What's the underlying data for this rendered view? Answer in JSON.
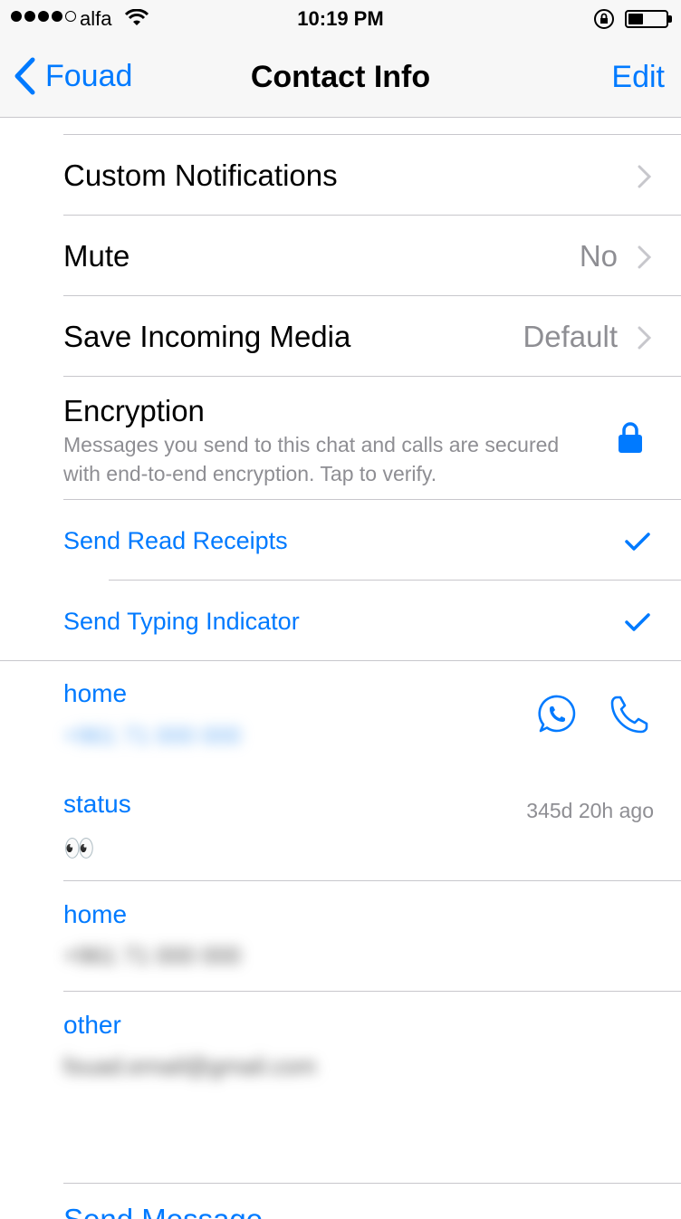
{
  "status_bar": {
    "carrier": "alfa",
    "time": "10:19 PM",
    "signal_bars": 4,
    "signal_total": 5,
    "battery_level": 0.4
  },
  "nav": {
    "back_label": "Fouad",
    "title": "Contact Info",
    "edit_label": "Edit"
  },
  "settings": {
    "custom_notifications": "Custom Notifications",
    "mute_label": "Mute",
    "mute_value": "No",
    "save_media_label": "Save Incoming Media",
    "save_media_value": "Default",
    "encryption_title": "Encryption",
    "encryption_desc": "Messages you send to this chat and calls are secured with end-to-end encryption. Tap to verify.",
    "send_read_receipts": "Send Read Receipts",
    "send_typing_indicator": "Send Typing Indicator"
  },
  "fields": {
    "phone1_label": "home",
    "phone1_value": "+961 71 000 000",
    "status_label": "status",
    "status_time": "345d 20h ago",
    "status_value": "👀",
    "phone2_label": "home",
    "phone2_value": "+961 71 000 000",
    "email_label": "other",
    "email_value": "fouad.email@gmail.com"
  },
  "actions": {
    "send_message": "Send Message"
  },
  "colors": {
    "accent": "#007aff",
    "secondary_text": "#8e8e93",
    "separator": "#c8c7cc",
    "bar_background": "#f7f7f7"
  },
  "icons": {
    "back": "chevron-left-icon",
    "disclosure": "chevron-right-icon",
    "lock": "lock-icon",
    "check": "checkmark-icon",
    "whatsapp": "whatsapp-icon",
    "phone": "phone-icon",
    "wifi": "wifi-icon",
    "rotation_lock": "rotation-lock-icon",
    "battery": "battery-icon"
  }
}
